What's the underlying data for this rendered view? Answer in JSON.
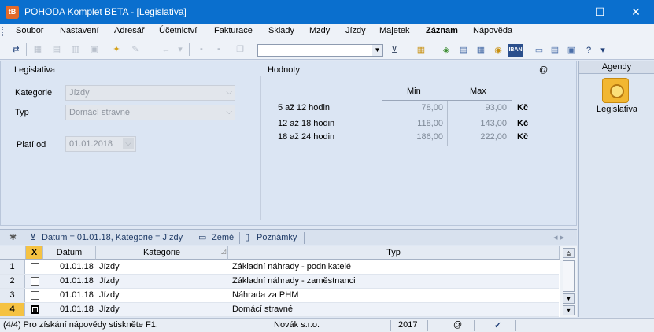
{
  "window": {
    "title": "POHODA Komplet BETA - [Legislativa]",
    "app_icon": "pohoda-logo",
    "controls": [
      "–",
      "☐",
      "✕"
    ]
  },
  "menu": [
    {
      "label": "Soubor"
    },
    {
      "label": "Nastavení"
    },
    {
      "label": "Adresář"
    },
    {
      "label": "Účetnictví"
    },
    {
      "label": "Fakturace"
    },
    {
      "label": "Sklady"
    },
    {
      "label": "Mzdy"
    },
    {
      "label": "Jízdy"
    },
    {
      "label": "Majetek"
    },
    {
      "label": "Záznam"
    },
    {
      "label": "Nápověda"
    }
  ],
  "toolbar": {
    "search_value": "",
    "iban_label": "IBAN"
  },
  "legislativa": {
    "section_title": "Legislativa",
    "kategorie_label": "Kategorie",
    "kategorie_value": "Jízdy",
    "typ_label": "Typ",
    "typ_value": "Domácí stravné",
    "plati_od_label": "Platí od",
    "plati_od_value": "01.01.2018"
  },
  "hodnoty": {
    "section_title": "Hodnoty",
    "at_symbol": "@",
    "min_label": "Min",
    "max_label": "Max",
    "rows": [
      {
        "label": "5 až 12 hodin",
        "min": "78,00",
        "max": "93,00",
        "currency": "Kč"
      },
      {
        "label": "12 až 18 hodin",
        "min": "118,00",
        "max": "143,00",
        "currency": "Kč"
      },
      {
        "label": "18 až 24 hodin",
        "min": "186,00",
        "max": "222,00",
        "currency": "Kč"
      }
    ]
  },
  "tabs": {
    "filter": "Datum = 01.01.18, Kategorie = Jízdy",
    "zeme": "Země",
    "poznamky": "Poznámky"
  },
  "table": {
    "headers": {
      "x": "X",
      "datum": "Datum",
      "kategorie": "Kategorie",
      "typ": "Typ"
    },
    "rows": [
      {
        "n": "1",
        "datum": "01.01.18",
        "kategorie": "Jízdy",
        "typ": "Základní náhrady - podnikatelé"
      },
      {
        "n": "2",
        "datum": "01.01.18",
        "kategorie": "Jízdy",
        "typ": "Základní náhrady - zaměstnanci"
      },
      {
        "n": "3",
        "datum": "01.01.18",
        "kategorie": "Jízdy",
        "typ": "Náhrada za PHM"
      },
      {
        "n": "4",
        "datum": "01.01.18",
        "kategorie": "Jízdy",
        "typ": "Domácí stravné"
      }
    ]
  },
  "agendy": {
    "header": "Agendy",
    "item": "Legislativa"
  },
  "status": {
    "help": "(4/4) Pro získání nápovědy stiskněte F1.",
    "company": "Novák s.r.o.",
    "year": "2017",
    "at": "@"
  },
  "colors": {
    "titlebar": "#0a6fce",
    "active_row": "#f5c242"
  }
}
